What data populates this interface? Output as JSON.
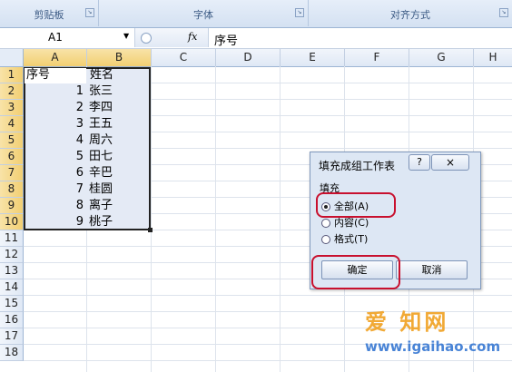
{
  "ribbon": {
    "groups": [
      "剪贴板",
      "字体",
      "对齐方式"
    ]
  },
  "formula_bar": {
    "name_box": "A1",
    "fx": "fx",
    "content": "序号"
  },
  "columns": [
    "A",
    "B",
    "C",
    "D",
    "E",
    "F",
    "G",
    "H"
  ],
  "rows": [
    "1",
    "2",
    "3",
    "4",
    "5",
    "6",
    "7",
    "8",
    "9",
    "10",
    "11",
    "12",
    "13",
    "14",
    "15",
    "16",
    "17",
    "18"
  ],
  "cells": {
    "A1": "序号",
    "B1": "姓名",
    "data": [
      {
        "a": "1",
        "b": "张三"
      },
      {
        "a": "2",
        "b": "李四"
      },
      {
        "a": "3",
        "b": "王五"
      },
      {
        "a": "4",
        "b": "周六"
      },
      {
        "a": "5",
        "b": "田七"
      },
      {
        "a": "6",
        "b": "辛巴"
      },
      {
        "a": "7",
        "b": "桂圆"
      },
      {
        "a": "8",
        "b": "离子"
      },
      {
        "a": "9",
        "b": "桃子"
      }
    ]
  },
  "dialog": {
    "title": "填充成组工作表",
    "help": "?",
    "close": "×",
    "group_label": "填充",
    "options": [
      "全部(A)",
      "内容(C)",
      "格式(T)"
    ],
    "selected_option": "全部(A)",
    "ok": "确定",
    "cancel": "取消"
  },
  "watermark": {
    "line1": "爱 知网",
    "line2": "www.igaihao.com"
  },
  "colors": {
    "highlight": "#c8102e",
    "selection": "#e4eaf5",
    "header_selected": "#f2cf72"
  }
}
